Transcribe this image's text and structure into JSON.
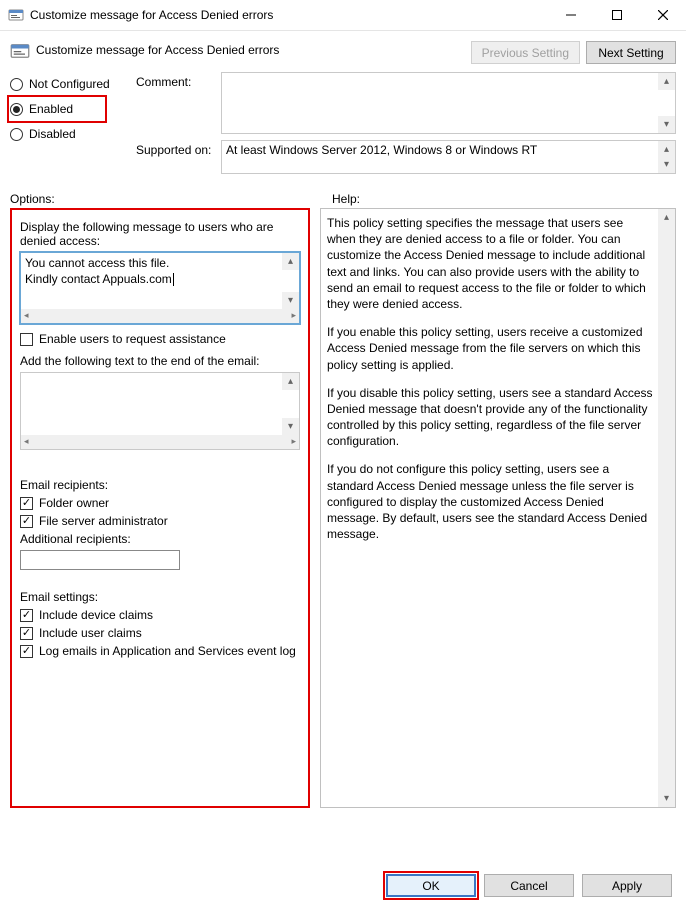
{
  "window": {
    "title": "Customize message for Access Denied errors"
  },
  "header": {
    "title": "Customize message for Access Denied errors",
    "prev_setting": "Previous Setting",
    "next_setting": "Next Setting"
  },
  "state": {
    "not_configured": "Not Configured",
    "enabled": "Enabled",
    "disabled": "Disabled",
    "selected": "enabled"
  },
  "form": {
    "comment_label": "Comment:",
    "comment_value": "",
    "supported_label": "Supported on:",
    "supported_value": "At least Windows Server 2012, Windows 8 or Windows RT"
  },
  "labels": {
    "options": "Options:",
    "help": "Help:"
  },
  "options": {
    "display_msg_label": "Display the following message to users who are denied access:",
    "display_msg_value": "You cannot access this file.\nKindly contact Appuals.com",
    "enable_assist_label": "Enable users to request assistance",
    "enable_assist_checked": false,
    "email_append_label": "Add the following text to the end of the email:",
    "email_append_value": "",
    "recipients_heading": "Email recipients:",
    "folder_owner_label": "Folder owner",
    "folder_owner_checked": true,
    "file_admin_label": "File server administrator",
    "file_admin_checked": true,
    "additional_label": "Additional recipients:",
    "additional_value": "",
    "settings_heading": "Email settings:",
    "device_claims_label": "Include device claims",
    "device_claims_checked": true,
    "user_claims_label": "Include user claims",
    "user_claims_checked": true,
    "log_emails_label": "Log emails in Application and Services event log",
    "log_emails_checked": true
  },
  "help": {
    "p1": "This policy setting specifies the message that users see when they are denied access to a file or folder. You can customize the Access Denied message to include additional text and links. You can also provide users with the ability to send an email to request access to the file or folder to which they were denied access.",
    "p2": "If you enable this policy setting, users receive a customized Access Denied message from the file servers on which this policy setting is applied.",
    "p3": "If you disable this policy setting, users see a standard Access Denied message that doesn't provide any of the functionality controlled by this policy setting, regardless of the file server configuration.",
    "p4": "If you do not configure this policy setting, users see a standard Access Denied message unless the file server is configured to display the customized Access Denied message. By default, users see the standard Access Denied message."
  },
  "buttons": {
    "ok": "OK",
    "cancel": "Cancel",
    "apply": "Apply"
  }
}
